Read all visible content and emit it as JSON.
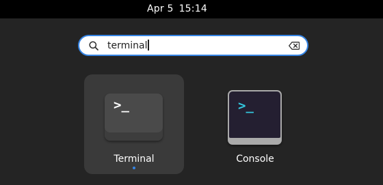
{
  "topbar": {
    "date": "Apr 5",
    "time": "15:14"
  },
  "search": {
    "query": "terminal",
    "search_icon": "search-icon",
    "clear_icon": "clear-text-icon",
    "accent": "#3584e4"
  },
  "results": [
    {
      "label": "Terminal",
      "icon": "terminal-app-icon",
      "icon_glyph": ">_",
      "selected": true,
      "running": true
    },
    {
      "label": "Console",
      "icon": "console-app-icon",
      "icon_glyph": ">_",
      "selected": false,
      "running": false
    }
  ],
  "colors": {
    "background": "#242424",
    "topbar": "#000000",
    "selected_tile": "#3a3a3a",
    "console_prompt": "#33c7de"
  }
}
